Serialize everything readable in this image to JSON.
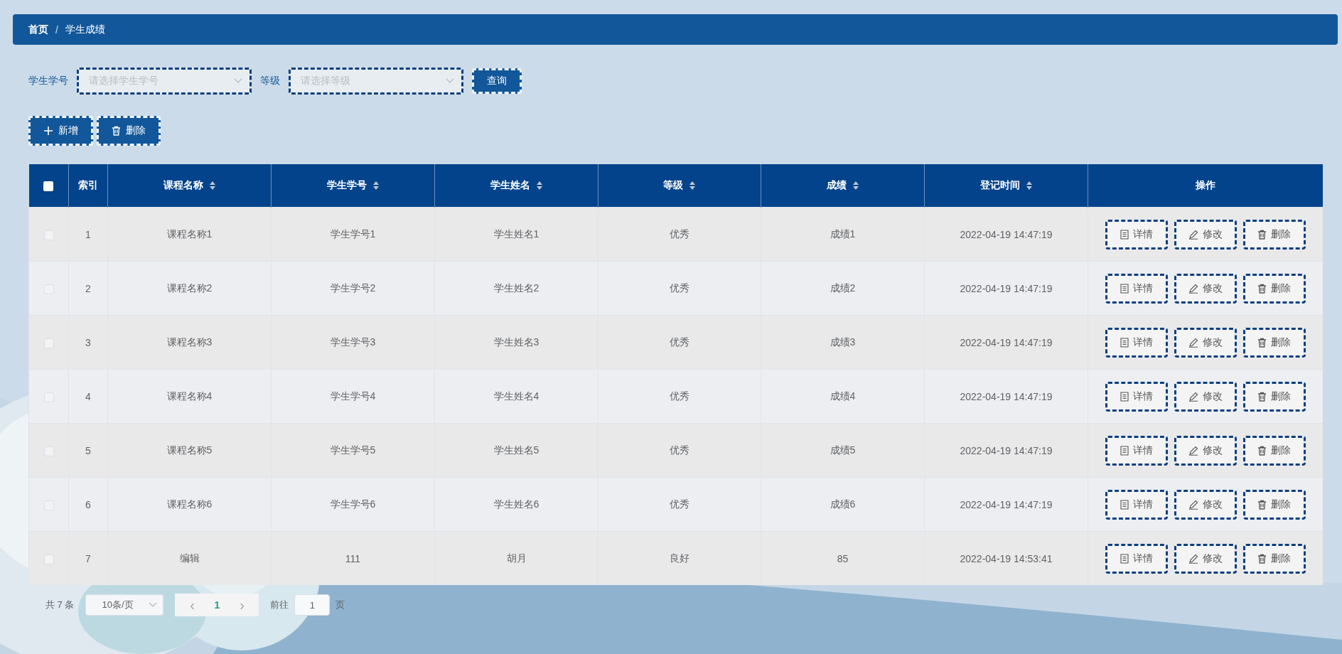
{
  "breadcrumb": [
    {
      "label": "首页",
      "current": false
    },
    {
      "label": "/",
      "kind": "separator"
    },
    {
      "label": "学生成绩",
      "current": true
    }
  ],
  "filters": [
    {
      "label": "学生学号",
      "placeholder": "请选择学生学号"
    },
    {
      "label": "等级",
      "placeholder": "请选择等级"
    }
  ],
  "search_button": "查询",
  "toolbar": [
    {
      "label": "新增",
      "kind": "add"
    },
    {
      "label": "删除",
      "kind": "delete"
    }
  ],
  "table": {
    "select_all": {
      "checked": false
    },
    "columns": [
      {
        "label": "索引",
        "sortable": false
      },
      {
        "label": "课程名称",
        "sortable": true
      },
      {
        "label": "学生学号",
        "sortable": true
      },
      {
        "label": "学生姓名",
        "sortable": true
      },
      {
        "label": "等级",
        "sortable": true
      },
      {
        "label": "成绩",
        "sortable": true
      },
      {
        "label": "登记时间",
        "sortable": true
      },
      {
        "label": "操作",
        "sortable": false
      }
    ],
    "rows": [
      {
        "checked": false,
        "cells": [
          "1",
          "课程名称1",
          "学生学号1",
          "学生姓名1",
          "优秀",
          "成绩1",
          "2022-04-19 14:47:19"
        ],
        "actions": [
          {
            "label": "详情",
            "kind": "detail"
          },
          {
            "label": "修改",
            "kind": "edit"
          },
          {
            "label": "删除",
            "kind": "delete"
          }
        ]
      },
      {
        "checked": false,
        "cells": [
          "2",
          "课程名称2",
          "学生学号2",
          "学生姓名2",
          "优秀",
          "成绩2",
          "2022-04-19 14:47:19"
        ],
        "actions": [
          {
            "label": "详情",
            "kind": "detail"
          },
          {
            "label": "修改",
            "kind": "edit"
          },
          {
            "label": "删除",
            "kind": "delete"
          }
        ]
      },
      {
        "checked": false,
        "cells": [
          "3",
          "课程名称3",
          "学生学号3",
          "学生姓名3",
          "优秀",
          "成绩3",
          "2022-04-19 14:47:19"
        ],
        "actions": [
          {
            "label": "详情",
            "kind": "detail"
          },
          {
            "label": "修改",
            "kind": "edit"
          },
          {
            "label": "删除",
            "kind": "delete"
          }
        ]
      },
      {
        "checked": false,
        "cells": [
          "4",
          "课程名称4",
          "学生学号4",
          "学生姓名4",
          "优秀",
          "成绩4",
          "2022-04-19 14:47:19"
        ],
        "actions": [
          {
            "label": "详情",
            "kind": "detail"
          },
          {
            "label": "修改",
            "kind": "edit"
          },
          {
            "label": "删除",
            "kind": "delete"
          }
        ]
      },
      {
        "checked": false,
        "cells": [
          "5",
          "课程名称5",
          "学生学号5",
          "学生姓名5",
          "优秀",
          "成绩5",
          "2022-04-19 14:47:19"
        ],
        "actions": [
          {
            "label": "详情",
            "kind": "detail"
          },
          {
            "label": "修改",
            "kind": "edit"
          },
          {
            "label": "删除",
            "kind": "delete"
          }
        ]
      },
      {
        "checked": false,
        "cells": [
          "6",
          "课程名称6",
          "学生学号6",
          "学生姓名6",
          "优秀",
          "成绩6",
          "2022-04-19 14:47:19"
        ],
        "actions": [
          {
            "label": "详情",
            "kind": "detail"
          },
          {
            "label": "修改",
            "kind": "edit"
          },
          {
            "label": "删除",
            "kind": "delete"
          }
        ]
      },
      {
        "checked": false,
        "cells": [
          "7",
          "编辑",
          "111",
          "胡月",
          "良好",
          "85",
          "2022-04-19 14:53:41"
        ],
        "actions": [
          {
            "label": "详情",
            "kind": "detail"
          },
          {
            "label": "修改",
            "kind": "edit"
          },
          {
            "label": "删除",
            "kind": "delete"
          }
        ]
      }
    ]
  },
  "pagination": {
    "total": "共 7 条",
    "page_size": "10条/页",
    "prev": "‹",
    "pages": [
      {
        "label": "1",
        "selected": true
      }
    ],
    "next": "›",
    "goto_label": "前往",
    "goto_value": "1",
    "goto_suffix": "页"
  }
}
